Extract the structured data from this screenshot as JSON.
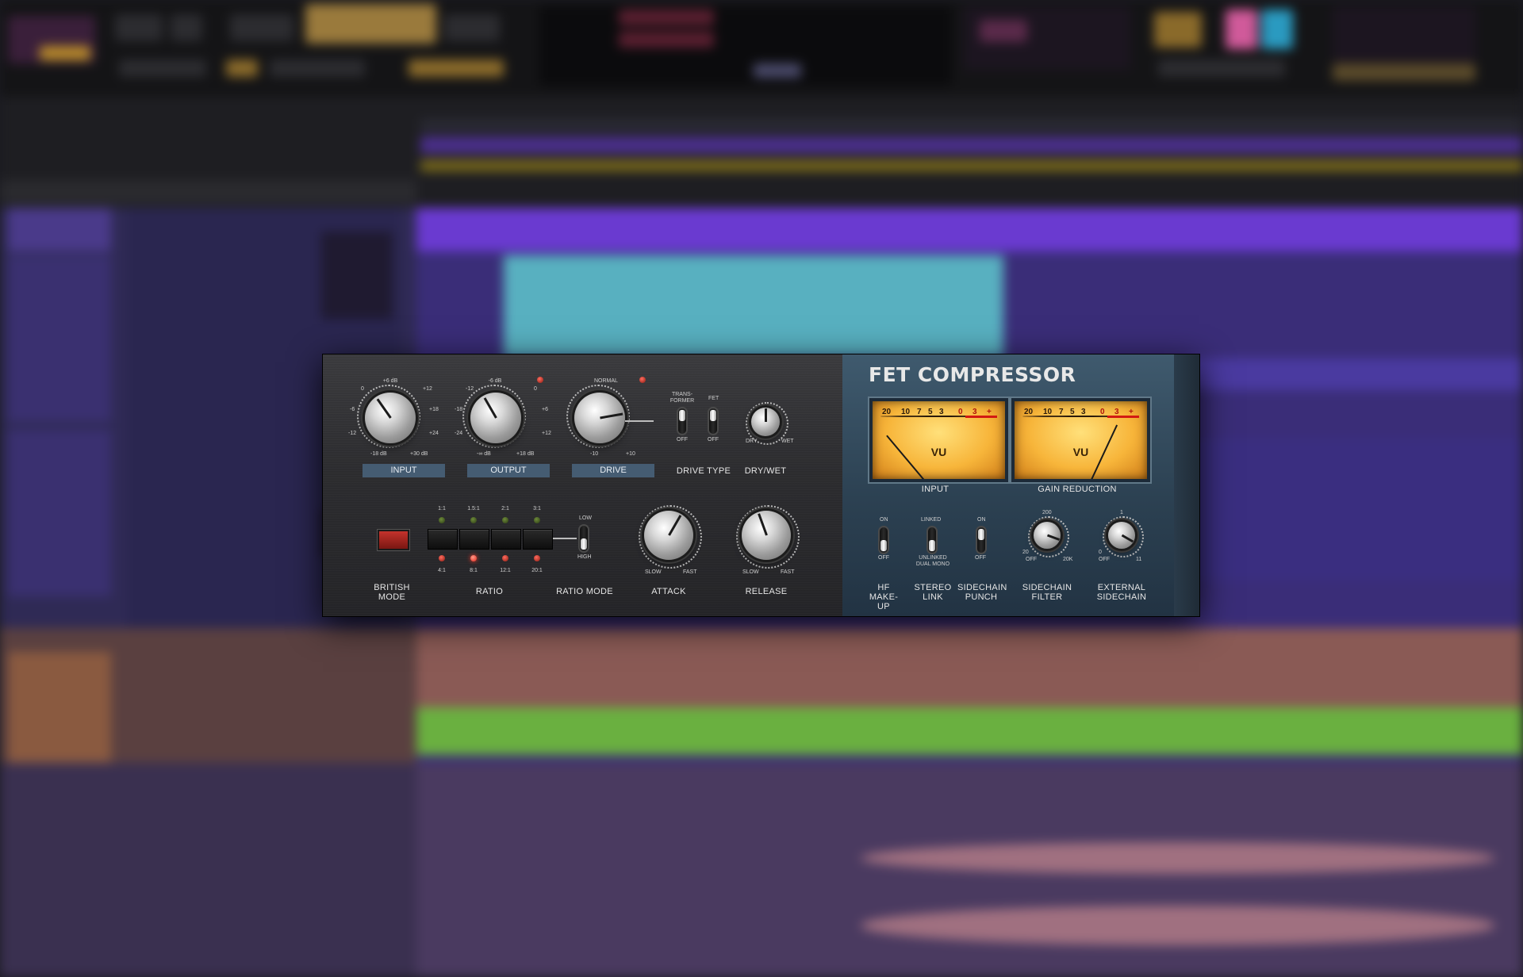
{
  "plugin": {
    "title": "FET COMPRESSOR",
    "knobs": {
      "input": {
        "label": "INPUT",
        "scale": [
          "+6 dB",
          "0",
          "+12",
          "-6",
          "+18",
          "-12",
          "+24",
          "-18 dB",
          "+30 dB"
        ]
      },
      "output": {
        "label": "OUTPUT",
        "scale": [
          "-6 dB",
          "-12",
          "0",
          "-18",
          "+6",
          "-24",
          "+12",
          "-∞ dB",
          "+18 dB"
        ]
      },
      "drive": {
        "label": "DRIVE",
        "scale": [
          "NORMAL",
          "-10",
          "+10"
        ]
      },
      "dry_wet": {
        "label": "DRY/WET",
        "min": "DRY",
        "max": "WET"
      },
      "attack": {
        "label": "ATTACK",
        "min": "SLOW",
        "max": "FAST"
      },
      "release": {
        "label": "RELEASE",
        "min": "SLOW",
        "max": "FAST"
      },
      "sidechain_filter": {
        "label": "SIDECHAIN FILTER",
        "scale": [
          "200",
          "20",
          "OFF",
          "20K"
        ]
      },
      "external_sidechain": {
        "label": "EXTERNAL SIDECHAIN",
        "scale": [
          "1",
          "OFF",
          "11",
          "0"
        ]
      }
    },
    "drive_type": {
      "label": "DRIVE TYPE",
      "transformer": "TRANS-FORMER",
      "fet": "FET",
      "off_left": "OFF",
      "off_right": "OFF"
    },
    "british_mode": {
      "label": "BRITISH MODE"
    },
    "ratio": {
      "label": "RATIO",
      "top": [
        "1:1",
        "1.5:1",
        "2:1",
        "3:1"
      ],
      "bottom": [
        "4:1",
        "8:1",
        "12:1",
        "20:1"
      ],
      "active": "8:1"
    },
    "ratio_mode": {
      "label": "RATIO MODE",
      "low": "LOW",
      "high": "HIGH"
    },
    "meters": [
      {
        "label": "INPUT"
      },
      {
        "label": "GAIN REDUCTION"
      }
    ],
    "meter_face": {
      "vu": "VU",
      "nums": [
        "20",
        "10",
        "7",
        "5",
        "3",
        "0",
        "3",
        "+"
      ]
    },
    "switches": {
      "hf_makeup": {
        "label": "HF MAKE-UP",
        "on": "ON",
        "off": "OFF"
      },
      "stereo_link": {
        "label": "STEREO LINK",
        "on": "LINKED",
        "off": "UNLINKED DUAL MONO"
      },
      "sidechain_punch": {
        "label": "SIDECHAIN PUNCH",
        "on": "ON",
        "off": "OFF"
      }
    }
  },
  "colors": {
    "accent_label_bg": "#455c72",
    "panel_blue": "#2c4152",
    "meter_amber": "#f7b53a",
    "led_red": "#e0261a"
  }
}
